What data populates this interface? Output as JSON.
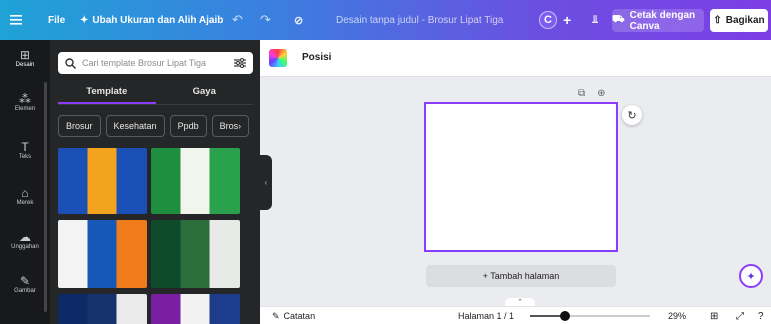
{
  "topbar": {
    "menu_icon": "hamburger-icon",
    "file_label": "File",
    "resize_label": "Ubah Ukuran dan Alih Ajaib",
    "design_title": "Desain tanpa judul - Brosur Lipat Tiga",
    "avatar_initial": "C",
    "print_label": "Cetak dengan Canva",
    "share_label": "Bagikan"
  },
  "rail": {
    "items": [
      {
        "label": "Desain",
        "icon": "layout-icon"
      },
      {
        "label": "Elemen",
        "icon": "shapes-icon"
      },
      {
        "label": "Teks",
        "icon": "text-icon"
      },
      {
        "label": "Merek",
        "icon": "brand-icon"
      },
      {
        "label": "Unggahan",
        "icon": "upload-icon"
      },
      {
        "label": "Gambar",
        "icon": "draw-icon"
      }
    ]
  },
  "panel": {
    "search_placeholder": "Cari template Brosur Lipat Tiga",
    "tabs": [
      "Template",
      "Gaya"
    ],
    "chips": [
      "Brosur",
      "Kesehatan",
      "Ppdb",
      "Bros"
    ]
  },
  "toolstrip": {
    "position_label": "Posisi"
  },
  "canvas": {
    "add_page_label": "+ Tambah halaman"
  },
  "bottombar": {
    "notes_label": "Catatan",
    "page_label": "Halaman 1 / 1",
    "zoom_label": "29%",
    "zoom_level": 0.29
  },
  "colors": {
    "accent": "#8b3dff",
    "topbar_start": "#1fa3d6",
    "topbar_end": "#7d3ee6"
  }
}
